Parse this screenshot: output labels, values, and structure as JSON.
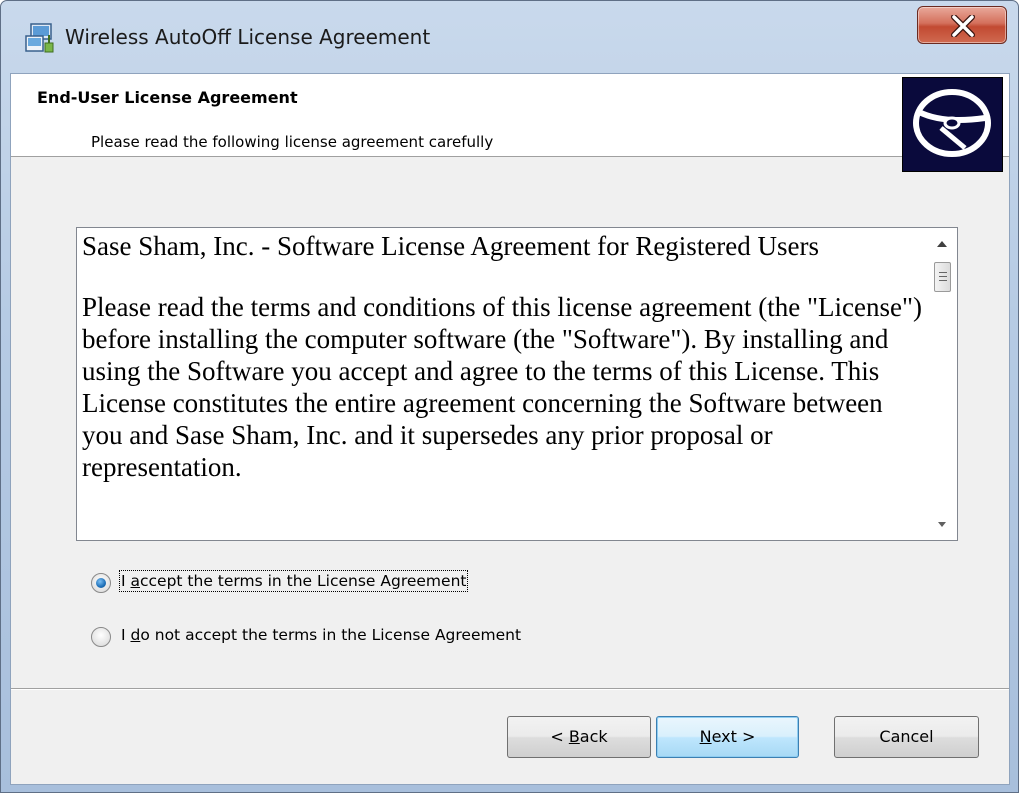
{
  "window": {
    "title": "Wireless AutoOff License Agreement"
  },
  "banner": {
    "title": "End-User License Agreement",
    "subtitle": "Please read the following license agreement carefully"
  },
  "license": {
    "paragraphs": [
      "Sase Sham, Inc. - Software License Agreement for Registered Users",
      "Please read the terms and conditions of this license agreement (the \"License\") before installing the computer software (the \"Software\"). By installing and using the Software you accept and agree to the terms of this License. This License constitutes the entire agreement concerning the Software between you and Sase Sham, Inc. and it supersedes any prior proposal or representation."
    ]
  },
  "options": {
    "accept": {
      "prefix": "I ",
      "accel": "a",
      "rest": "ccept the terms in the License Agreement",
      "checked": true
    },
    "decline": {
      "prefix": "I ",
      "accel": "d",
      "rest": "o not accept the terms in the License Agreement",
      "checked": false
    }
  },
  "buttons": {
    "back": {
      "prefix": "< ",
      "accel": "B",
      "rest": "ack"
    },
    "next": {
      "prefix": "",
      "accel": "N",
      "rest": "ext >"
    },
    "cancel": {
      "label": "Cancel"
    }
  },
  "colors": {
    "close_button": "#c24a32",
    "default_button_border": "#3c7fb1",
    "dialog_background": "#f0f0f0",
    "logo_background": "#0a0a3c"
  },
  "icons": {
    "app": "installer-icon",
    "close": "close-icon",
    "logo": "disc-logo-icon"
  }
}
